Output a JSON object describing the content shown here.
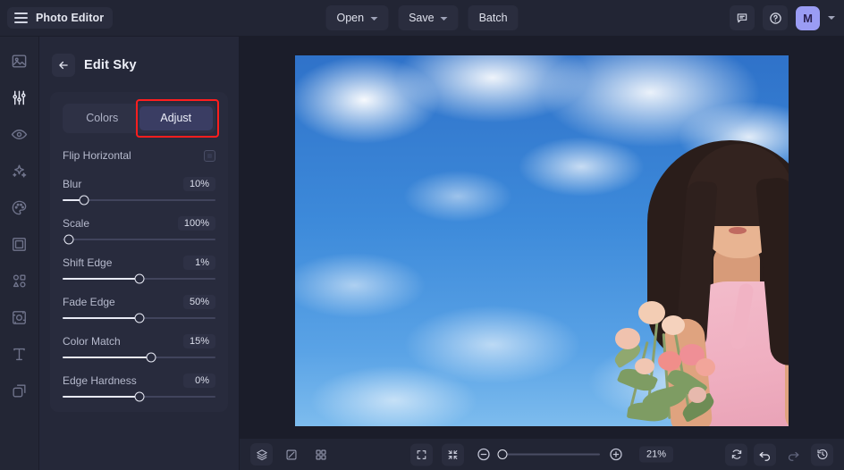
{
  "app": {
    "title": "Photo Editor",
    "accent": "#9a9cf4",
    "highlight": "#ff1e1e"
  },
  "topbar": {
    "menu_icon": "hamburger-icon",
    "buttons": [
      {
        "label": "Open",
        "has_caret": true
      },
      {
        "label": "Save",
        "has_caret": true
      },
      {
        "label": "Batch",
        "has_caret": false
      }
    ],
    "right": {
      "feedback_icon": "comment-icon",
      "help_icon": "question-circle-icon",
      "avatar_initial": "M",
      "account_caret_icon": "chevron-down-icon"
    }
  },
  "rail": {
    "items": [
      {
        "icon": "image-icon",
        "active": false
      },
      {
        "icon": "sliders-icon",
        "active": true
      },
      {
        "icon": "eye-icon",
        "active": false
      },
      {
        "icon": "sparkles-icon",
        "active": false
      },
      {
        "icon": "palette-icon",
        "active": false
      },
      {
        "icon": "frame-icon",
        "active": false
      },
      {
        "icon": "shapes-icon",
        "active": false
      },
      {
        "icon": "crop-rotate-icon",
        "active": false
      },
      {
        "icon": "text-icon",
        "active": false
      },
      {
        "icon": "layers-copy-icon",
        "active": false
      }
    ]
  },
  "panel": {
    "back_icon": "arrow-left-icon",
    "title": "Edit Sky",
    "tabs": [
      {
        "label": "Colors",
        "active": false
      },
      {
        "label": "Adjust",
        "active": true,
        "highlighted": true
      }
    ],
    "flip": {
      "label": "Flip Horizontal",
      "checked": false
    },
    "sliders": [
      {
        "label": "Blur",
        "value": "10%",
        "thumb_pct": 14,
        "fill_pct": 14
      },
      {
        "label": "Scale",
        "value": "100%",
        "thumb_pct": 4,
        "fill_pct": 0
      },
      {
        "label": "Shift Edge",
        "value": "1%",
        "thumb_pct": 50,
        "fill_pct": 50
      },
      {
        "label": "Fade Edge",
        "value": "50%",
        "thumb_pct": 50,
        "fill_pct": 50
      },
      {
        "label": "Color Match",
        "value": "15%",
        "thumb_pct": 58,
        "fill_pct": 58
      },
      {
        "label": "Edge Hardness",
        "value": "0%",
        "thumb_pct": 50,
        "fill_pct": 50
      }
    ]
  },
  "bottombar": {
    "left_tools": [
      {
        "icon": "layers-icon"
      },
      {
        "icon": "compare-icon"
      },
      {
        "icon": "grid-icon"
      }
    ],
    "view_tools": [
      {
        "icon": "fullscreen-icon"
      },
      {
        "icon": "fit-screen-icon"
      }
    ],
    "zoom": {
      "out_icon": "minus-circle-icon",
      "in_icon": "plus-circle-icon",
      "level": "21%",
      "thumb_pct": 3
    },
    "right_tools": [
      {
        "icon": "reset-icon",
        "enabled": true
      },
      {
        "icon": "undo-icon",
        "enabled": true
      },
      {
        "icon": "redo-icon",
        "enabled": false
      },
      {
        "icon": "history-icon",
        "enabled": true
      }
    ]
  },
  "canvas": {
    "image_alt": "woman-with-flower-bouquet-against-blue-sky"
  }
}
